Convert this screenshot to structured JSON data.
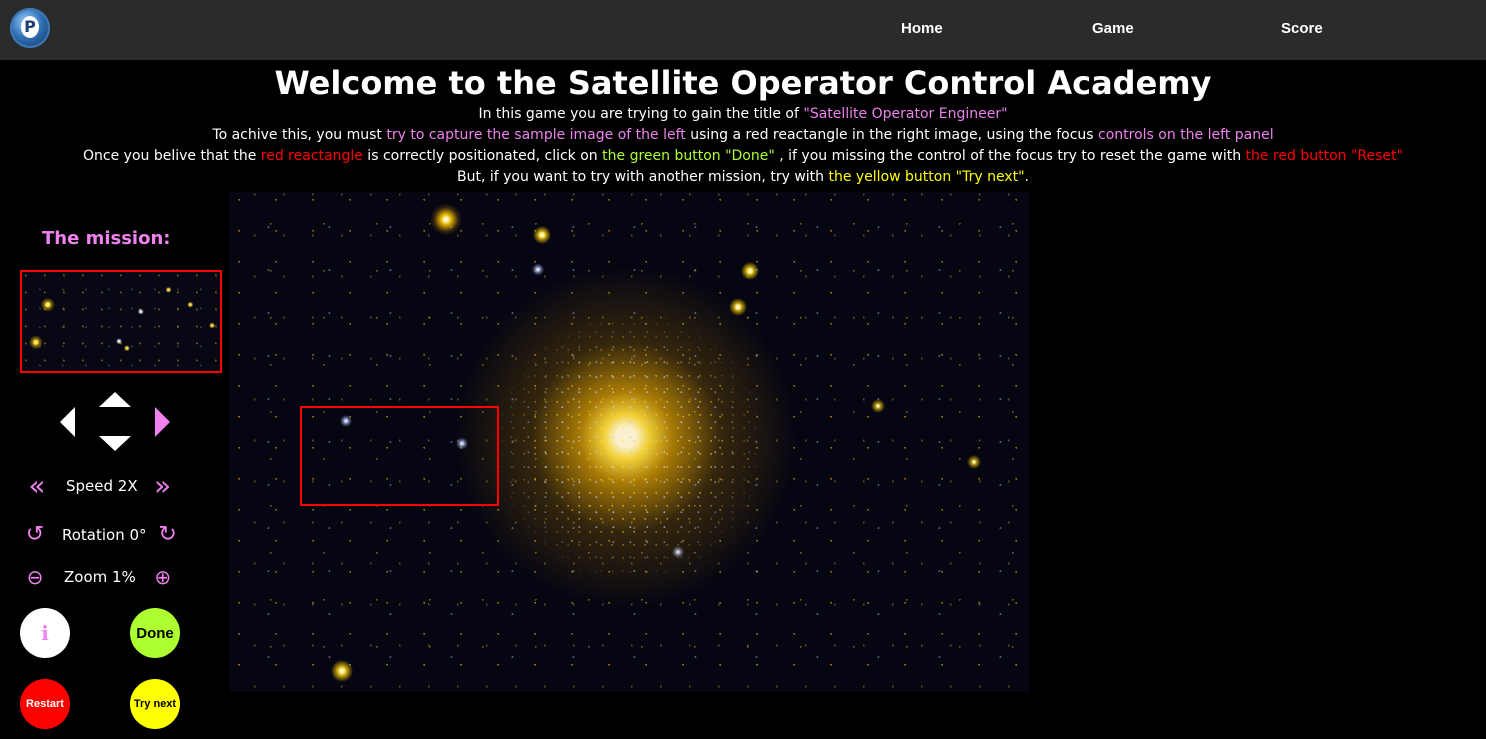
{
  "nav": {
    "home": "Home",
    "game": "Game",
    "score": "Score"
  },
  "header": {
    "title": "Welcome to the Satellite Operator Control Academy"
  },
  "instructions": {
    "line1_a": "In this game you are trying to gain the title of ",
    "line1_b": "\"Satellite Operator Engineer\"",
    "line2_a": "To achive this, you must ",
    "line2_b": "try to capture the sample image of the left",
    "line2_c": " using a red reactangle in the right image, using the focus ",
    "line2_d": "controls on the left panel",
    "line3_a": "Once you belive that the ",
    "line3_b": "red reactangle",
    "line3_c": " is correctly positionated, click on ",
    "line3_d": "the green button \"Done\"",
    "line3_e": " , if you missing the control of the focus try to reset the game with ",
    "line3_f": "the red button \"Reset\"",
    "line4_a": "But, if you want to try with another mission, try with ",
    "line4_b": "the yellow button \"Try next\"",
    "line4_c": "."
  },
  "panel": {
    "mission_label": "The mission:",
    "speed_label": "Speed 2X",
    "rotation_label": "Rotation 0°",
    "zoom_label": "Zoom 1%",
    "icons": {
      "move_up": "triangle-up",
      "move_down": "triangle-down",
      "move_left": "triangle-left",
      "move_right": "triangle-right",
      "speed_down": "double-chevron-left",
      "speed_up": "double-chevron-right",
      "rotate_left": "rotate-ccw",
      "rotate_right": "rotate-cw",
      "zoom_out": "zoom-out",
      "zoom_in": "zoom-in"
    }
  },
  "buttons": {
    "info": "i",
    "done": "Done",
    "restart": "Restart",
    "try_next": "Try next"
  },
  "colors": {
    "accent_pink": "#ee82ee",
    "selection_red": "#ff0000",
    "done_green": "#adff2f",
    "try_next_yellow": "#ffff00",
    "navbar_bg": "#2b2b2b"
  }
}
